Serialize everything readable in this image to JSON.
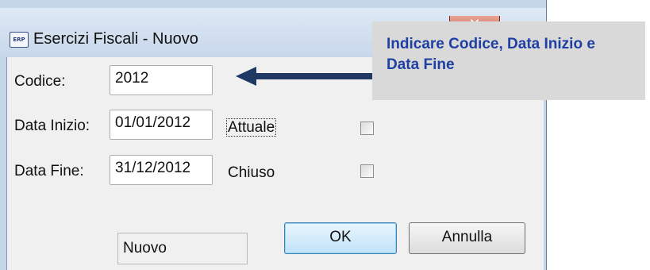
{
  "window": {
    "title": "Esercizi Fiscali - Nuovo",
    "icon": "erp-app-icon",
    "icon_text": "ERP",
    "close_glyph": "✕"
  },
  "form": {
    "codice_label": "Codice:",
    "codice_value": "2012",
    "data_inizio_label": "Data Inizio:",
    "data_inizio_value": "01/01/2012",
    "data_fine_label": "Data Fine:",
    "data_fine_value": "31/12/2012",
    "attuale_label": "Attuale",
    "attuale_checked": false,
    "chiuso_label": "Chiuso",
    "chiuso_checked": false,
    "status_value": "Nuovo"
  },
  "buttons": {
    "ok_label": "OK",
    "cancel_label": "Annulla"
  },
  "callout": {
    "text": "Indicare Codice, Data Inizio e Data Fine",
    "color": "#1f3fa3"
  },
  "colors": {
    "title_bar": "#c7d7ea",
    "arrow": "#1f3864"
  }
}
